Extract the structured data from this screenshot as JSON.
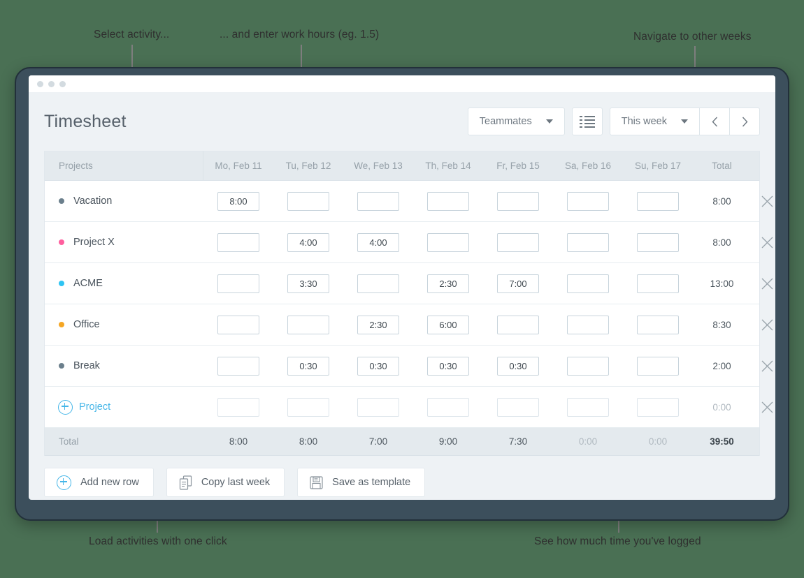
{
  "annotations": [
    {
      "id": "a1",
      "text": "Select activity..."
    },
    {
      "id": "a2",
      "text": "... and enter work hours (eg. 1.5)"
    },
    {
      "id": "a3",
      "text": "Navigate to other weeks"
    },
    {
      "id": "a4",
      "text": "Load activities with one click"
    },
    {
      "id": "a5",
      "text": "See how much time you've logged"
    }
  ],
  "header": {
    "title": "Timesheet",
    "teammates_label": "Teammates",
    "list_view_icon": "list-icon",
    "week_label": "This week",
    "prev_icon": "chevron-left-icon",
    "next_icon": "chevron-right-icon"
  },
  "table": {
    "columns": [
      "Projects",
      "Mo, Feb 11",
      "Tu, Feb 12",
      "We, Feb 13",
      "Th, Feb 14",
      "Fr, Feb 15",
      "Sa, Feb 16",
      "Su, Feb 17",
      "Total"
    ],
    "rows": [
      {
        "name": "Vacation",
        "color": "#6b7f8c",
        "values": [
          "8:00",
          "",
          "",
          "",
          "",
          "",
          ""
        ],
        "total": "8:00",
        "total_muted": false
      },
      {
        "name": "Project X",
        "color": "#ff5f9e",
        "values": [
          "",
          "4:00",
          "4:00",
          "",
          "",
          "",
          ""
        ],
        "total": "8:00",
        "total_muted": false
      },
      {
        "name": "ACME",
        "color": "#2ec4f3",
        "values": [
          "",
          "3:30",
          "",
          "2:30",
          "7:00",
          "",
          ""
        ],
        "total": "13:00",
        "total_muted": false
      },
      {
        "name": "Office",
        "color": "#f5a623",
        "values": [
          "",
          "",
          "2:30",
          "6:00",
          "",
          "",
          ""
        ],
        "total": "8:30",
        "total_muted": false
      },
      {
        "name": "Break",
        "color": "#6b7f8c",
        "values": [
          "",
          "0:30",
          "0:30",
          "0:30",
          "0:30",
          "",
          ""
        ],
        "total": "2:00",
        "total_muted": false
      }
    ],
    "add_row": {
      "label": "Project",
      "icon": "plus-circle-icon",
      "values": [
        "",
        "",
        "",
        "",
        "",
        "",
        ""
      ],
      "total": "0:00",
      "total_muted": true
    },
    "delete_icon": "close-icon",
    "totals": {
      "label": "Total",
      "values": [
        "8:00",
        "8:00",
        "7:00",
        "9:00",
        "7:30",
        "0:00",
        "0:00"
      ],
      "muted_flags": [
        false,
        false,
        false,
        false,
        false,
        true,
        true
      ],
      "grand_total": "39:50"
    }
  },
  "footer": {
    "buttons": [
      {
        "label": "Add new row",
        "icon": "plus-circle-icon"
      },
      {
        "label": "Copy last week",
        "icon": "copy-icon"
      },
      {
        "label": "Save as template",
        "icon": "floppy-disk-icon"
      }
    ]
  },
  "colors": {
    "page_background": "#4a7054",
    "accent": "#45b6e8",
    "device_bezel": "#3c4f5c",
    "app_background": "#eef2f5",
    "header_row": "#e4eaee"
  }
}
